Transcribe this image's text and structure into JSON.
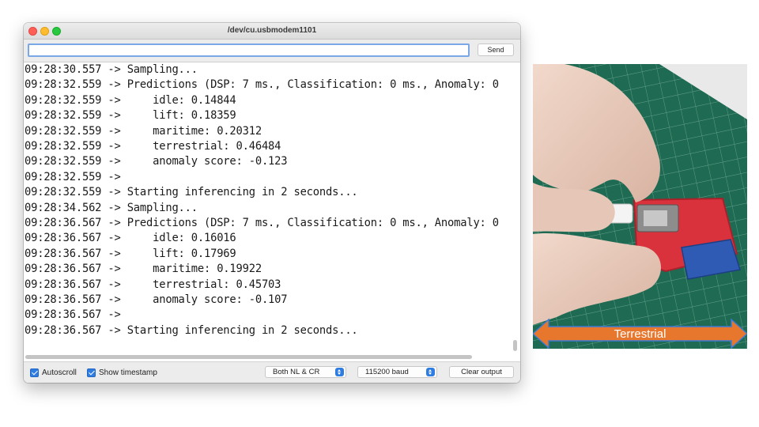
{
  "window": {
    "title": "/dev/cu.usbmodem1101",
    "input_value": "",
    "send_label": "Send"
  },
  "output_lines": [
    "09:28:30.557 -> Sampling...",
    "09:28:32.559 -> Predictions (DSP: 7 ms., Classification: 0 ms., Anomaly: 0",
    "09:28:32.559 ->     idle: 0.14844",
    "09:28:32.559 ->     lift: 0.18359",
    "09:28:32.559 ->     maritime: 0.20312",
    "09:28:32.559 ->     terrestrial: 0.46484",
    "09:28:32.559 ->     anomaly score: -0.123",
    "09:28:32.559 ->",
    "09:28:32.559 -> Starting inferencing in 2 seconds...",
    "09:28:34.562 -> Sampling...",
    "09:28:36.567 -> Predictions (DSP: 7 ms., Classification: 0 ms., Anomaly: 0",
    "09:28:36.567 ->     idle: 0.16016",
    "09:28:36.567 ->     lift: 0.17969",
    "09:28:36.567 ->     maritime: 0.19922",
    "09:28:36.567 ->     terrestrial: 0.45703",
    "09:28:36.567 ->     anomaly score: -0.107",
    "09:28:36.567 ->",
    "09:28:36.567 -> Starting inferencing in 2 seconds..."
  ],
  "footer": {
    "autoscroll_label": "Autoscroll",
    "autoscroll_checked": true,
    "timestamp_label": "Show timestamp",
    "timestamp_checked": true,
    "line_ending": "Both NL & CR",
    "baud_rate": "115200 baud",
    "clear_label": "Clear output"
  },
  "photo": {
    "banner_label": "Terrestrial",
    "banner_color": "#e8772e"
  },
  "colors": {
    "accent": "#2f7de1",
    "mat": "#1f6a52",
    "board": "#d9323d"
  }
}
